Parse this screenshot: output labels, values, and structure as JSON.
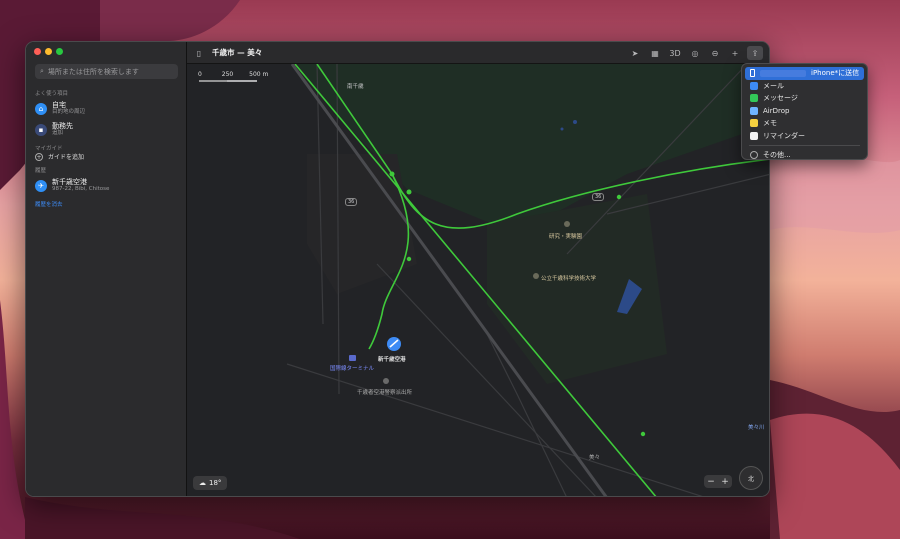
{
  "window": {
    "title": "千歳市 — 美々"
  },
  "sidebar": {
    "search_placeholder": "場所または住所を検索します",
    "section_favorites": "よく使う項目",
    "favorites": [
      {
        "title": "自宅",
        "subtitle": "目的地の周辺"
      },
      {
        "title": "勤務先",
        "subtitle": "追加"
      }
    ],
    "section_guides": "マイガイド",
    "add_guide": "ガイドを追加",
    "section_recents": "履歴",
    "recents": [
      {
        "title": "新千歳空港",
        "subtitle": "987-22, Bibi, Chitose"
      }
    ],
    "clear_recents": "履歴を消去"
  },
  "toolbar": {
    "threed_label": "3D"
  },
  "map": {
    "scale": {
      "zero": "0",
      "mid": "250",
      "end": "500 m"
    },
    "labels": {
      "minami_chitose": "南千歳",
      "kenkyu": "研究・実験園",
      "university": "公立千歳科学技術大学",
      "airport": "新千歳空港",
      "terminal": "国際線ターミナル",
      "police": "千歳者空港警察派出所",
      "bibi": "美々",
      "bibigawa": "美々川"
    },
    "routes": {
      "r1": "36",
      "r2": "36",
      "r3": "36",
      "r4": "36"
    },
    "weather": "18°",
    "compass": "北"
  },
  "share_menu": {
    "items": [
      {
        "label": "iPhone*に送信",
        "icon": "iphone-icon",
        "selected": true
      },
      {
        "label": "メール",
        "icon": "mail-icon"
      },
      {
        "label": "メッセージ",
        "icon": "messages-icon"
      },
      {
        "label": "AirDrop",
        "icon": "airdrop-icon"
      },
      {
        "label": "メモ",
        "icon": "notes-icon"
      },
      {
        "label": "リマインダー",
        "icon": "reminders-icon"
      }
    ],
    "more": "その他..."
  },
  "colors": {
    "accent": "#2f6fd7",
    "rail": "#3fc93b",
    "airport_pin": "#3d8bf5"
  }
}
